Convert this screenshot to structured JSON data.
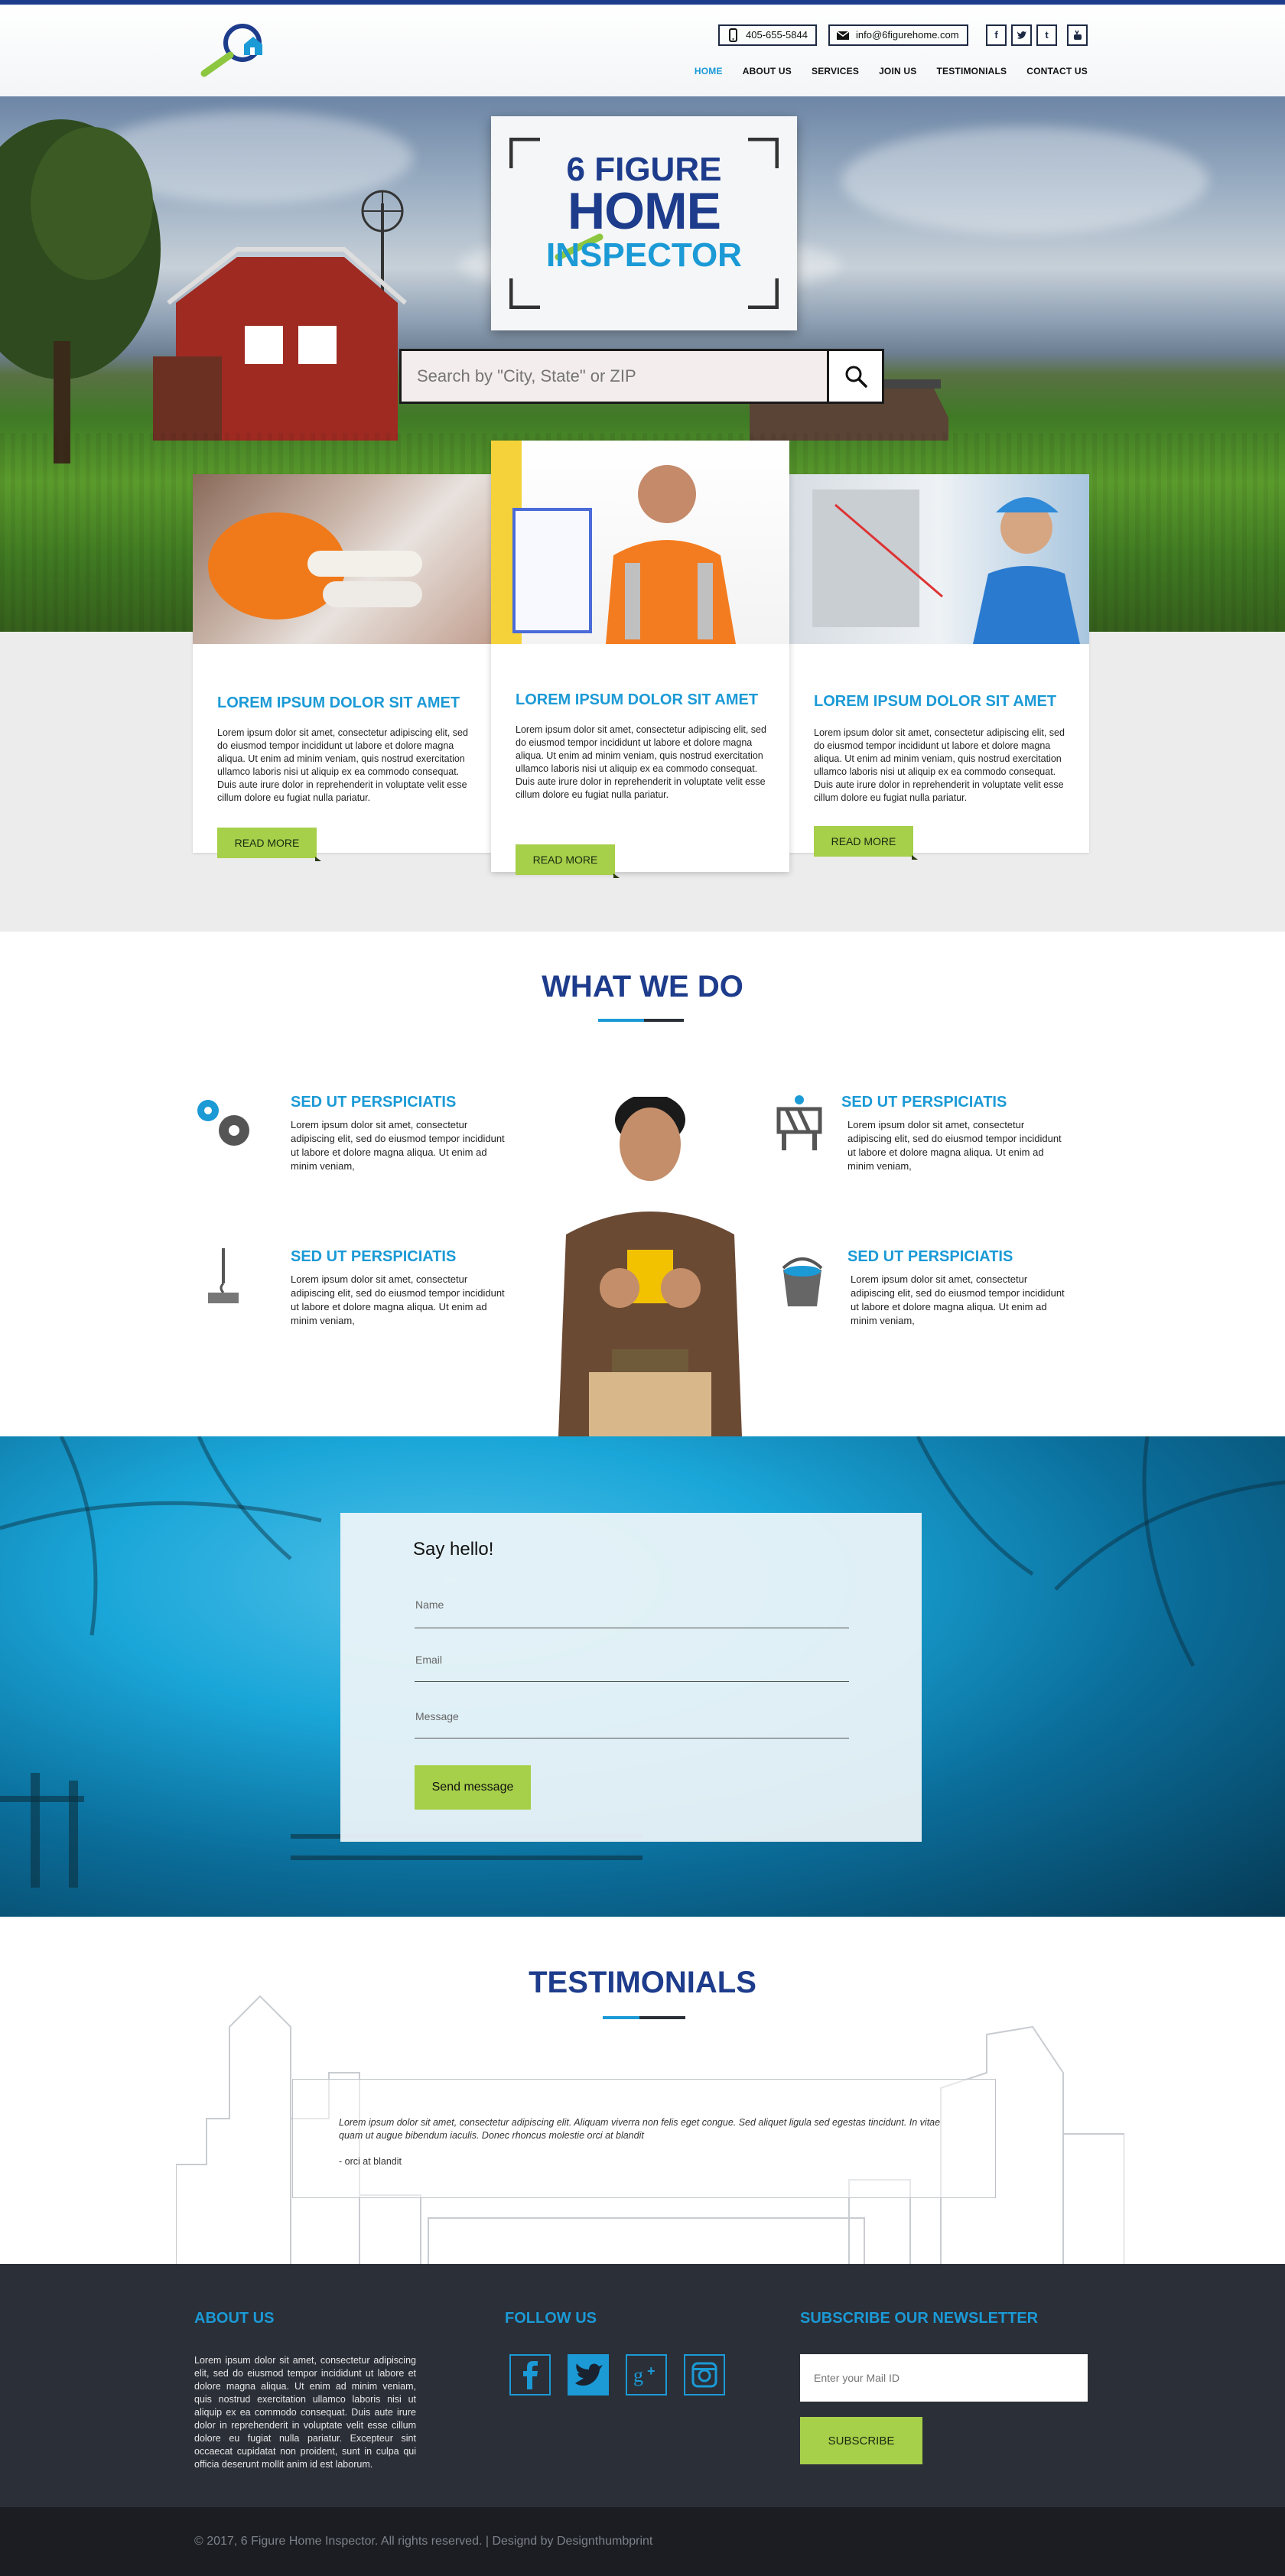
{
  "header": {
    "phone": "405-655-5844",
    "email": "info@6figurehome.com",
    "social": [
      "f",
      "t-bird",
      "t",
      "yt"
    ],
    "nav": [
      {
        "label": "HOME",
        "active": true
      },
      {
        "label": "ABOUT US",
        "active": false
      },
      {
        "label": "SERVICES",
        "active": false
      },
      {
        "label": "JOIN US",
        "active": false
      },
      {
        "label": "TESTIMONIALS",
        "active": false
      },
      {
        "label": "CONTACT US",
        "active": false
      }
    ]
  },
  "hero": {
    "logo_lines": [
      "6 FIGURE",
      "HOME",
      "INSPECTOR"
    ],
    "search_placeholder": "Search by \"City, State\" or ZIP"
  },
  "services": {
    "cards": [
      {
        "title": "LOREM IPSUM DOLOR SIT AMET",
        "text": "Lorem ipsum dolor sit amet, consectetur adipiscing elit, sed do eiusmod tempor incididunt ut labore et dolore magna aliqua. Ut enim ad minim veniam, quis nostrud exercitation ullamco laboris nisi ut aliquip ex ea commodo consequat. Duis aute irure dolor in reprehenderit in voluptate velit esse cillum dolore eu fugiat nulla pariatur.",
        "button": "READ MORE"
      },
      {
        "title": "LOREM IPSUM DOLOR SIT AMET",
        "text": "Lorem ipsum dolor sit amet, consectetur adipiscing elit, sed do eiusmod tempor incididunt ut labore et dolore magna aliqua. Ut enim ad minim veniam, quis nostrud exercitation ullamco laboris nisi ut aliquip ex ea commodo consequat. Duis aute irure dolor in reprehenderit in voluptate velit esse cillum dolore eu fugiat nulla pariatur.",
        "button": "READ MORE"
      },
      {
        "title": "LOREM IPSUM DOLOR SIT AMET",
        "text": "Lorem ipsum dolor sit amet, consectetur adipiscing elit, sed do eiusmod tempor incididunt ut labore et dolore magna aliqua. Ut enim ad minim veniam, quis nostrud exercitation ullamco laboris nisi ut aliquip ex ea commodo consequat. Duis aute irure dolor in reprehenderit in voluptate velit esse cillum dolore eu fugiat nulla pariatur.",
        "button": "READ MORE"
      }
    ]
  },
  "what_we_do": {
    "title": "WHAT WE DO",
    "features": [
      {
        "icon": "gears-icon",
        "title": "SED UT PERSPICIATIS",
        "text": "Lorem ipsum dolor sit amet, consectetur adipiscing elit, sed do eiusmod tempor incididunt ut labore et dolore magna aliqua. Ut enim ad minim veniam,"
      },
      {
        "icon": "barrier-icon",
        "title": "SED UT PERSPICIATIS",
        "text": "Lorem ipsum dolor sit amet, consectetur adipiscing elit, sed do eiusmod tempor incididunt ut labore et dolore magna aliqua. Ut enim ad minim veniam,"
      },
      {
        "icon": "crane-hook-icon",
        "title": "SED UT PERSPICIATIS",
        "text": "Lorem ipsum dolor sit amet, consectetur adipiscing elit, sed do eiusmod tempor incididunt ut labore et dolore magna aliqua. Ut enim ad minim veniam,"
      },
      {
        "icon": "paint-bucket-icon",
        "title": "SED UT PERSPICIATIS",
        "text": "Lorem ipsum dolor sit amet, consectetur adipiscing elit, sed do eiusmod tempor incididunt ut labore et dolore magna aliqua. Ut enim ad minim veniam,"
      }
    ]
  },
  "contact": {
    "title": "Say hello!",
    "name_label": "Name",
    "email_label": "Email",
    "message_label": "Message",
    "button": "Send message"
  },
  "testimonials": {
    "title": "TESTIMONIALS",
    "quote": "Lorem ipsum dolor sit amet, consectetur adipiscing elit. Aliquam viverra non felis eget congue. Sed aliquet ligula sed egestas tincidunt. In vitae quam ut augue bibendum iaculis. Donec rhoncus molestie orci at blandit",
    "author": "- orci at blandit"
  },
  "footer": {
    "about_title": "ABOUT US",
    "about_text": "Lorem ipsum dolor sit amet, consectetur adipiscing elit, sed do eiusmod tempor incididunt ut labore et dolore magna aliqua. Ut enim ad minim veniam, quis nostrud exercitation ullamco laboris nisi ut aliquip ex ea commodo consequat. Duis aute irure dolor in reprehenderit in voluptate velit esse cillum dolore eu fugiat nulla pariatur. Excepteur sint occaecat cupidatat non proident, sunt in culpa qui officia deserunt mollit anim id est laborum.",
    "follow_title": "FOLLOW US",
    "follow_icons": [
      "f",
      "twitter-bird",
      "g+",
      "instagram"
    ],
    "newsletter_title": "SUBSCRIBE OUR NEWSLETTER",
    "newsletter_placeholder": "Enter your Mail ID",
    "subscribe": "SUBSCRIBE",
    "copyright": "© 2017, 6 Figure Home Inspector. All rights reserved.  |  Designd by Designthumbprint"
  },
  "colors": {
    "navy": "#1e3c8c",
    "accent_blue": "#1b9ad6",
    "accent_green": "#a6cf4a",
    "footer_bg": "#2b2f38"
  }
}
